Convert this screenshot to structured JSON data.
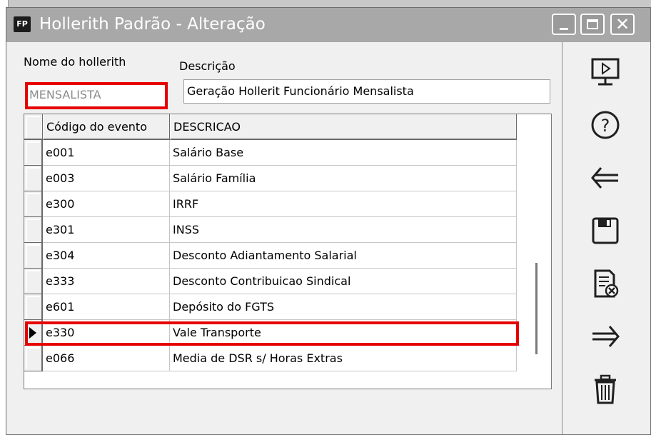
{
  "window": {
    "title": "Hollerith Padrão - Alteração",
    "app_icon_text": "FP"
  },
  "form": {
    "nome_label": "Nome do hollerith",
    "nome_value": "MENSALISTA",
    "descricao_label": "Descrição",
    "descricao_value": "Geração Hollerit Funcionário Mensalista"
  },
  "grid": {
    "columns": [
      "Código do evento",
      "DESCRICAO"
    ],
    "rows": [
      {
        "code": "e001",
        "desc": "Salário Base"
      },
      {
        "code": "e003",
        "desc": "Salário Família"
      },
      {
        "code": "e300",
        "desc": "IRRF"
      },
      {
        "code": "e301",
        "desc": "INSS"
      },
      {
        "code": "e304",
        "desc": "Desconto Adiantamento Salarial"
      },
      {
        "code": "e333",
        "desc": "Desconto Contribuicao Sindical"
      },
      {
        "code": "e601",
        "desc": "Depósito do FGTS"
      },
      {
        "code": "e330",
        "desc": "Vale Transporte"
      },
      {
        "code": "e066",
        "desc": "Media de DSR s/ Horas Extras"
      }
    ],
    "current_row": 7
  },
  "toolbar": {
    "buttons": [
      "monitor-play-icon",
      "help-icon",
      "back-arrow-icon",
      "save-icon",
      "cancel-document-icon",
      "forward-arrow-icon",
      "trash-icon"
    ]
  },
  "colors": {
    "highlight": "#e60000",
    "titlebar": "#a8a8a8"
  }
}
